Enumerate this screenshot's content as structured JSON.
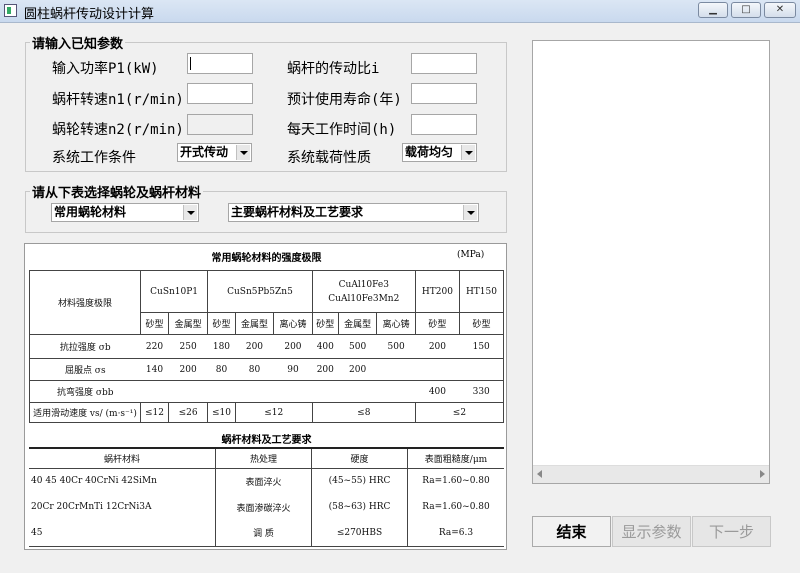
{
  "window": {
    "title": "圆柱蜗杆传动设计计算"
  },
  "group_known": {
    "legend": "请输入已知参数",
    "power_label": "输入功率P1(kW)",
    "worm_speed_label": "蜗杆转速n1(r/min)",
    "wheel_speed_label": "蜗轮转速n2(r/min)",
    "condition_label": "系统工作条件",
    "condition_value": "开式传动",
    "ratio_label": "蜗杆的传动比i",
    "life_label": "预计使用寿命(年)",
    "hours_label": "每天工作时间(h)",
    "load_label": "系统载荷性质",
    "load_value": "载荷均匀"
  },
  "group_material": {
    "legend": "请从下表选择蜗轮及蜗杆材料",
    "wheel_select": "常用蜗轮材料",
    "worm_select": "主要蜗杆材料及工艺要求"
  },
  "table1": {
    "title": "常用蜗轮材料的强度极限",
    "unit": "(MPa)",
    "header_label": "材料强度极限",
    "materials": [
      "CuSn10P1",
      "CuSn5Pb5Zn5",
      "CuAl10Fe3",
      "CuAl10Fe3Mn2",
      "HT200",
      "HT150"
    ],
    "casts": [
      "砂型",
      "金属型",
      "砂型",
      "金属型",
      "离心铸",
      "砂型",
      "金属型",
      "离心铸",
      "砂型",
      "砂型"
    ],
    "rows": [
      {
        "label": "抗拉强度 σb",
        "cells": [
          "220",
          "250",
          "180",
          "200",
          "200",
          "400",
          "500",
          "500",
          "200",
          "150"
        ]
      },
      {
        "label": "屈服点 σs",
        "cells": [
          "140",
          "200",
          "80",
          "80",
          "90",
          "200",
          "200",
          "",
          "",
          ""
        ]
      },
      {
        "label": "抗弯强度 σbb",
        "cells": [
          "",
          "",
          "",
          "",
          "",
          "",
          "",
          "",
          "400",
          "330"
        ]
      }
    ],
    "speed_label": "适用滑动速度 vs/ (m·s⁻¹)",
    "speed_cells": [
      "≤12",
      "≤26",
      "≤10",
      "≤12",
      "≤8",
      "≤2"
    ]
  },
  "table2": {
    "title": "蜗杆材料及工艺要求",
    "headers": [
      "蜗杆材料",
      "热处理",
      "硬度",
      "表面粗糙度/μm"
    ],
    "rows": [
      [
        "40 45 40Cr 40CrNi 42SiMn",
        "表面淬火",
        "(45~55) HRC",
        "Ra=1.60~0.80"
      ],
      [
        "20Cr 20CrMnTi 12CrNi3A",
        "表面渗碳淬火",
        "(58~63) HRC",
        "Ra=1.60~0.80"
      ],
      [
        "45",
        "调 质",
        "≤270HBS",
        "Ra=6.3"
      ]
    ]
  },
  "buttons": {
    "finish": "结束",
    "show": "显示参数",
    "next": "下一步"
  }
}
